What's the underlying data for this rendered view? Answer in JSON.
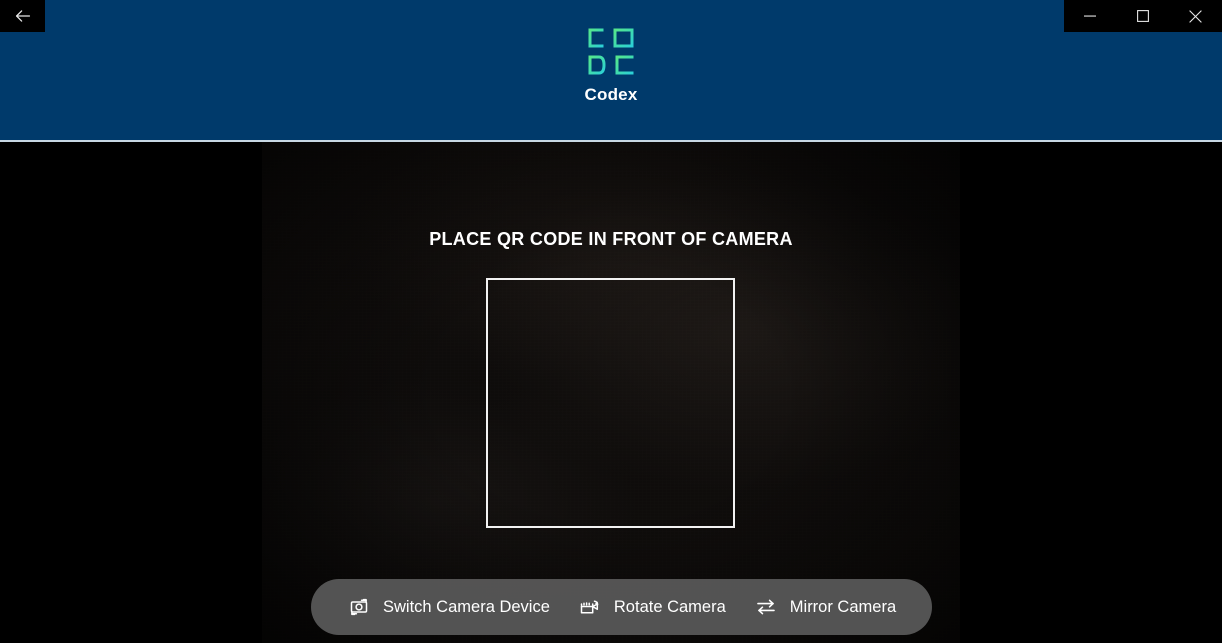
{
  "window": {
    "back_label": "Back",
    "back_icon": "arrow-left-icon",
    "controls": [
      {
        "name": "minimize",
        "icon": "minimize-icon",
        "label": "Minimize"
      },
      {
        "name": "maximize",
        "icon": "maximize-icon",
        "label": "Maximize"
      },
      {
        "name": "close",
        "icon": "close-icon",
        "label": "Close"
      }
    ]
  },
  "header": {
    "app_name": "Codex",
    "logo_icon": "codex-qr-logo-icon",
    "background_color": "#003A6B",
    "logo_gradient_start": "#4EE08A",
    "logo_gradient_end": "#2FD3D0"
  },
  "scanner": {
    "prompt": "PLACE QR CODE IN FRONT OF CAMERA",
    "viewfinder_border_color": "#F2F2F2",
    "feed_background_color": "#100D0B"
  },
  "toolbar": {
    "background_color": "#5A5A5A",
    "buttons": [
      {
        "label": "Switch Camera Device",
        "icon": "switch-camera-icon",
        "name": "switch-camera-device-button"
      },
      {
        "label": "Rotate Camera",
        "icon": "rotate-camera-icon",
        "name": "rotate-camera-button"
      },
      {
        "label": "Mirror Camera",
        "icon": "mirror-camera-icon",
        "name": "mirror-camera-button"
      }
    ]
  }
}
